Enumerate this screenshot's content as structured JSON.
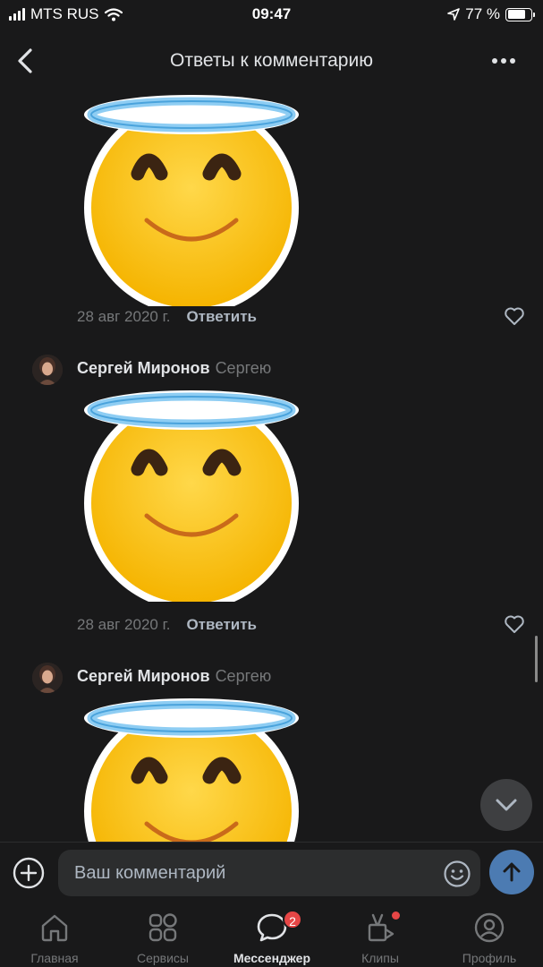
{
  "status_bar": {
    "carrier": "MTS RUS",
    "time": "09:47",
    "battery": "77 %",
    "battery_level": 0.77
  },
  "header": {
    "title": "Ответы к комментарию"
  },
  "comments": [
    {
      "sticker": "angel-smiley-sticker",
      "date": "28 авг 2020 г.",
      "reply": "Ответить"
    },
    {
      "author": "Сергей Миронов",
      "reply_to": "Сергею",
      "sticker": "angel-smiley-sticker",
      "date": "28 авг 2020 г.",
      "reply": "Ответить"
    },
    {
      "author": "Сергей Миронов",
      "reply_to": "Сергею",
      "sticker": "angel-smiley-sticker"
    }
  ],
  "input": {
    "placeholder": "Ваш комментарий"
  },
  "tabs": [
    {
      "label": "Главная",
      "icon": "home-icon"
    },
    {
      "label": "Сервисы",
      "icon": "services-icon"
    },
    {
      "label": "Мессенджер",
      "icon": "messenger-icon",
      "badge": "2",
      "active": true
    },
    {
      "label": "Клипы",
      "icon": "clips-icon"
    },
    {
      "label": "Профиль",
      "icon": "profile-icon"
    }
  ],
  "colors": {
    "background": "#19191a",
    "accent": "#4c7bb2",
    "badge": "#e64646",
    "sticker_yellow": "#ffc928",
    "halo_blue": "#8ecdf3"
  }
}
